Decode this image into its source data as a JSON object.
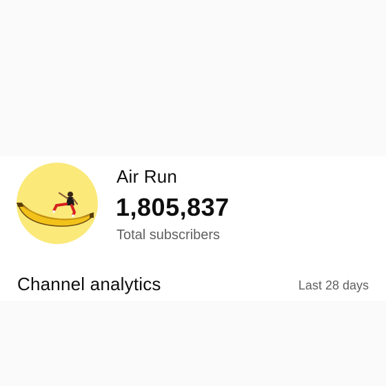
{
  "channel": {
    "name": "Air Run",
    "subscriber_count": "1,805,837",
    "subscriber_label": "Total subscribers",
    "avatar_icon": "banana-runner-avatar-icon",
    "avatar_background": "#fbe979"
  },
  "analytics": {
    "title": "Channel analytics",
    "period": "Last 28 days"
  }
}
